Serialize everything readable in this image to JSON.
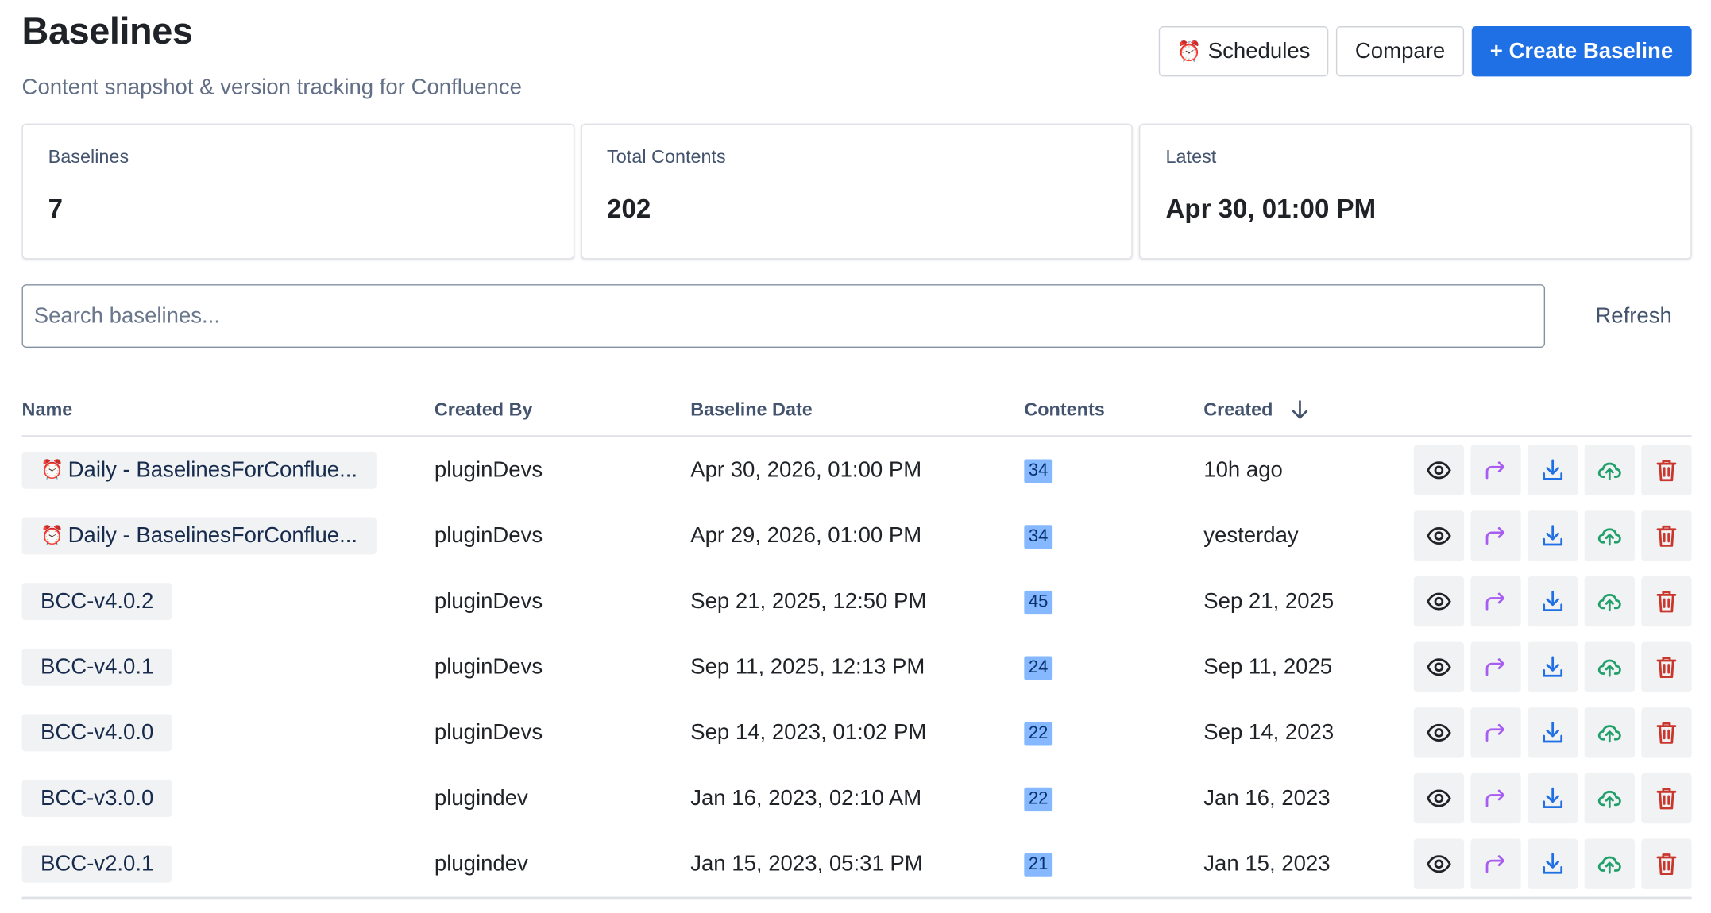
{
  "header": {
    "title": "Baselines",
    "subtitle": "Content snapshot & version tracking for Confluence",
    "schedules_label": "Schedules",
    "compare_label": "Compare",
    "create_label": "+ Create Baseline"
  },
  "stats": [
    {
      "label": "Baselines",
      "value": "7"
    },
    {
      "label": "Total Contents",
      "value": "202"
    },
    {
      "label": "Latest",
      "value": "Apr 30, 01:00 PM"
    }
  ],
  "search": {
    "placeholder": "Search baselines...",
    "value": ""
  },
  "refresh_label": "Refresh",
  "table": {
    "columns": [
      "Name",
      "Created By",
      "Baseline Date",
      "Contents",
      "Created"
    ],
    "sort_column": "Created",
    "sort_direction": "descending",
    "rows": [
      {
        "name": "Daily - BaselinesForConflue...",
        "scheduled": true,
        "created_by": "pluginDevs",
        "baseline_date": "Apr 30, 2026, 01:00 PM",
        "contents": "34",
        "created": "10h ago"
      },
      {
        "name": "Daily - BaselinesForConflue...",
        "scheduled": true,
        "created_by": "pluginDevs",
        "baseline_date": "Apr 29, 2026, 01:00 PM",
        "contents": "34",
        "created": "yesterday"
      },
      {
        "name": "BCC-v4.0.2",
        "scheduled": false,
        "created_by": "pluginDevs",
        "baseline_date": "Sep 21, 2025, 12:50 PM",
        "contents": "45",
        "created": "Sep 21, 2025"
      },
      {
        "name": "BCC-v4.0.1",
        "scheduled": false,
        "created_by": "pluginDevs",
        "baseline_date": "Sep 11, 2025, 12:13 PM",
        "contents": "24",
        "created": "Sep 11, 2025"
      },
      {
        "name": "BCC-v4.0.0",
        "scheduled": false,
        "created_by": "pluginDevs",
        "baseline_date": "Sep 14, 2023, 01:02 PM",
        "contents": "22",
        "created": "Sep 14, 2023"
      },
      {
        "name": "BCC-v3.0.0",
        "scheduled": false,
        "created_by": "plugindev",
        "baseline_date": "Jan 16, 2023, 02:10 AM",
        "contents": "22",
        "created": "Jan 16, 2023"
      },
      {
        "name": "BCC-v2.0.1",
        "scheduled": false,
        "created_by": "plugindev",
        "baseline_date": "Jan 15, 2023, 05:31 PM",
        "contents": "21",
        "created": "Jan 15, 2023"
      }
    ]
  },
  "row_actions": [
    "eye-icon",
    "share-arrow-icon",
    "download-icon",
    "upload-cloud-icon",
    "trash-icon"
  ],
  "colors": {
    "primary": "#1f6fe5",
    "lozenge_bg": "#85b8ff",
    "share_icon": "#a75cf2",
    "download_icon": "#1f6fe5",
    "upload_icon": "#22a06b",
    "trash_icon": "#c9372c"
  }
}
